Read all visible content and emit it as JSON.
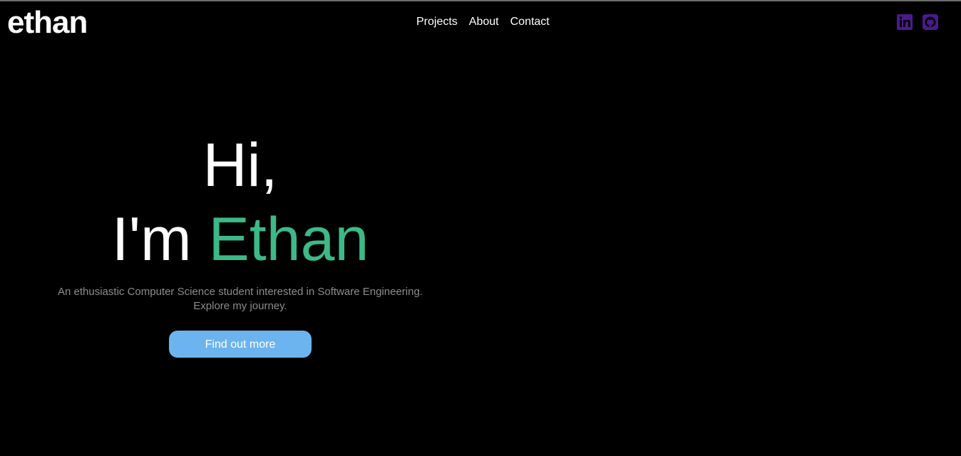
{
  "header": {
    "logo_text": "ethan",
    "nav": [
      {
        "label": "Projects"
      },
      {
        "label": "About"
      },
      {
        "label": "Contact"
      }
    ],
    "socials": [
      {
        "icon": "linkedin-icon"
      },
      {
        "icon": "github-icon"
      }
    ]
  },
  "hero": {
    "greeting": "Hi,",
    "intro_prefix": "I'm ",
    "name": "Ethan",
    "tagline_line1": "An ethusiastic Computer Science student interested in Software Engineering.",
    "tagline_line2": "Explore my journey.",
    "cta_label": "Find out more"
  },
  "colors": {
    "background": "#000000",
    "accent_name": "#3cb987",
    "button": "#6cb4ef",
    "social_icon": "#4b1a8c",
    "tagline": "#8c8c8c"
  }
}
